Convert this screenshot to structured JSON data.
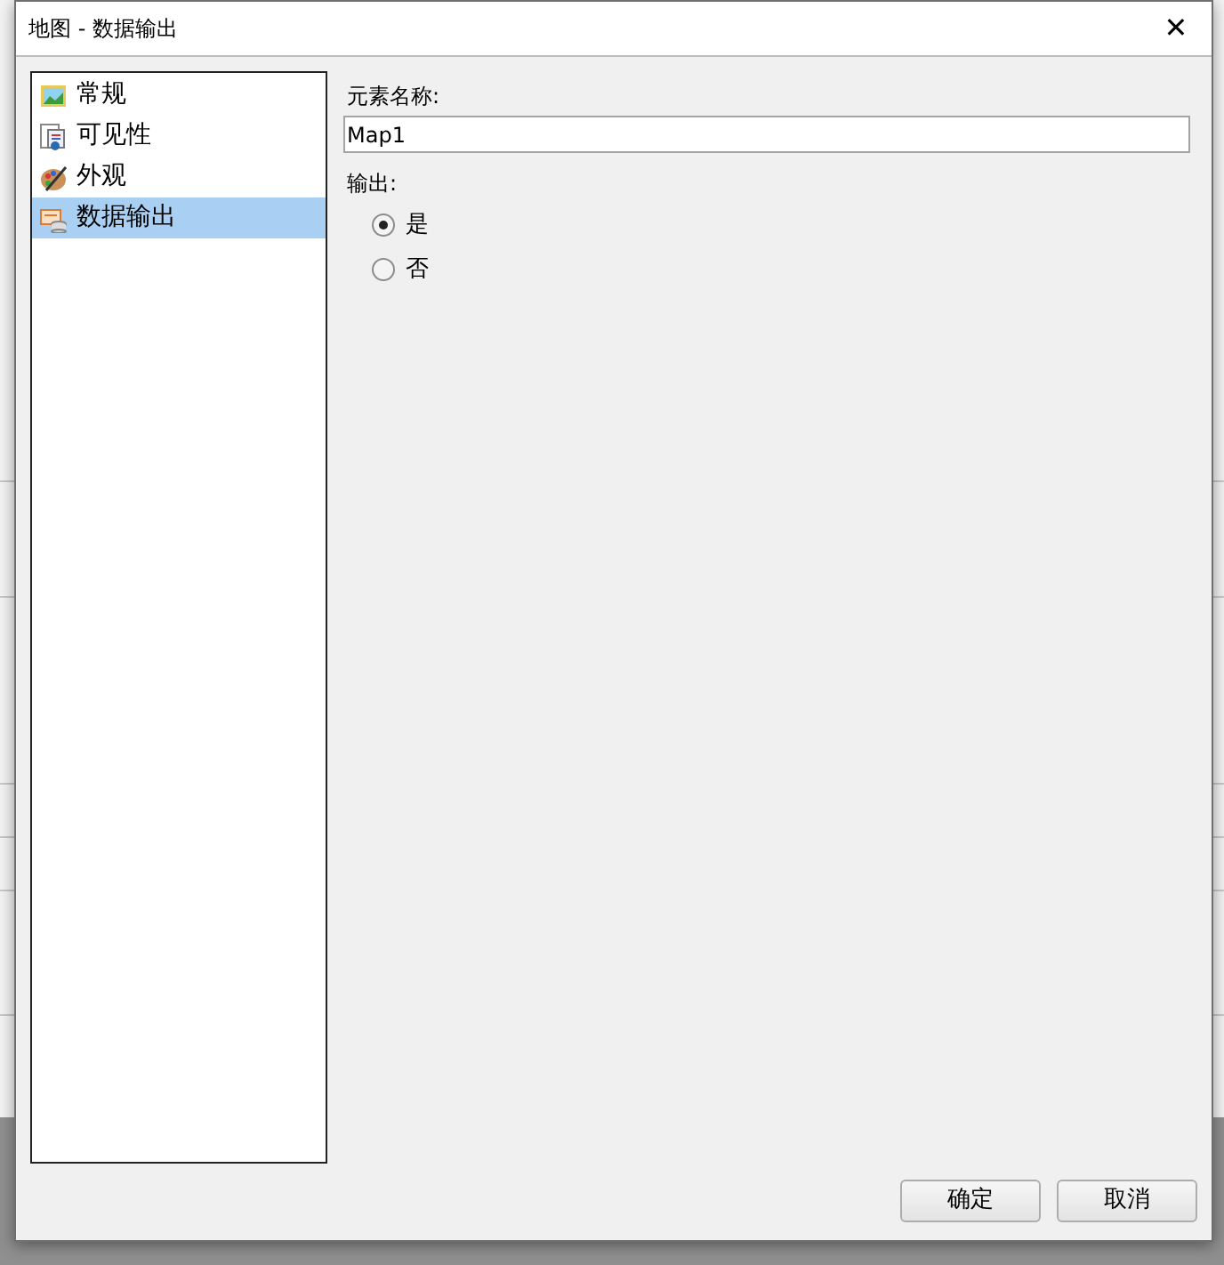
{
  "window": {
    "title": "地图 - 数据输出",
    "close": "✕"
  },
  "sidebar": {
    "items": [
      {
        "label": "常规",
        "selected": false
      },
      {
        "label": "可见性",
        "selected": false
      },
      {
        "label": "外观",
        "selected": false
      },
      {
        "label": "数据输出",
        "selected": true
      }
    ]
  },
  "element_name": {
    "label": "元素名称:",
    "value": "Map1"
  },
  "output": {
    "label": "输出:",
    "options": [
      {
        "label": "是",
        "selected": true
      },
      {
        "label": "否",
        "selected": false
      }
    ]
  },
  "buttons": [
    "确定",
    "取消"
  ]
}
